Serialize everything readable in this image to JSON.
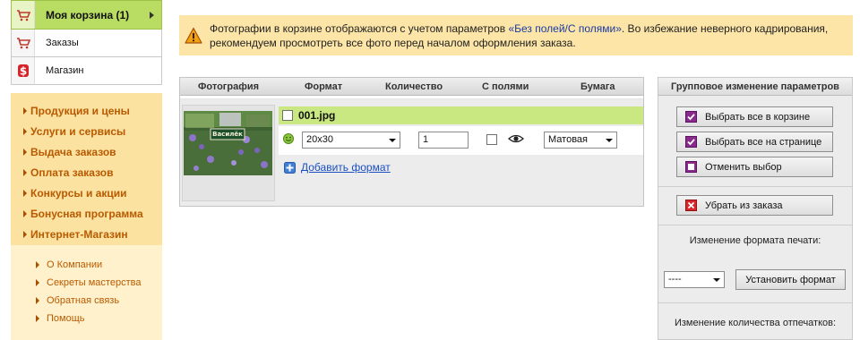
{
  "top_menu": [
    {
      "label": "Моя корзина (1)",
      "active": true,
      "icon": "cart-icon"
    },
    {
      "label": "Заказы",
      "active": false,
      "icon": "cart-icon"
    },
    {
      "label": "Магазин",
      "active": false,
      "icon": "dollar-icon"
    }
  ],
  "nav_main": [
    "Продукция и цены",
    "Услуги и сервисы",
    "Выдача заказов",
    "Оплата заказов",
    "Конкурсы и акции",
    "Бонусная программа",
    "Интернет-Магазин"
  ],
  "nav_secondary": [
    "О Компании",
    "Секреты мастерства",
    "Обратная связь",
    "Помощь"
  ],
  "notice": {
    "text_before": "Фотографии в корзине отображаются с учетом параметров ",
    "link": "«Без полей/С полями»",
    "text_after": ". Во избежание неверного кадрирования, рекомендуем просмотреть все фото перед началом оформления заказа."
  },
  "table": {
    "headers": {
      "photo": "Фотография",
      "format": "Формат",
      "quantity": "Количество",
      "borders": "С полями",
      "paper": "Бумага"
    },
    "item": {
      "filename": "001.jpg",
      "thumb_caption": "Василёк",
      "format_value": "20x30",
      "quantity_value": "1",
      "paper_value": "Матовая"
    },
    "add_format_label": "Добавить формат"
  },
  "panel": {
    "title": "Групповое изменение параметров",
    "select_all_cart": "Выбрать все в корзине",
    "select_all_page": "Выбрать все на странице",
    "deselect": "Отменить выбор",
    "remove_from_order": "Убрать из заказа",
    "format_change_label": "Изменение формата печати:",
    "format_select_value": "----",
    "set_format_button": "Установить формат",
    "quantity_change_label": "Изменение количества отпечатков:"
  },
  "colors": {
    "accent_green": "#b9dc63",
    "nav_orange_bg": "#fbe2a1",
    "nav_link": "#b95a00",
    "notice_bg": "#fce5a6",
    "link_blue": "#1a4fc2"
  }
}
